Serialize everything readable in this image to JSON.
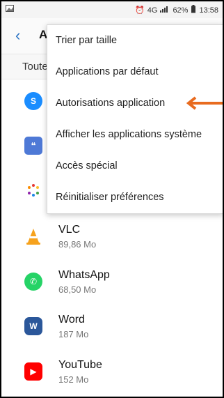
{
  "status_bar": {
    "left_icon": "gallery-icon",
    "right_icons": [
      "alarm-icon",
      "4g-icon",
      "signal-icon"
    ],
    "battery": "62%",
    "time": "13:58"
  },
  "header": {
    "back_icon": "chevron-left-icon",
    "title": "A"
  },
  "filter": {
    "label": "Toute"
  },
  "menu": {
    "items": [
      {
        "label": "Trier par taille"
      },
      {
        "label": "Applications par défaut"
      },
      {
        "label": "Autorisations application"
      },
      {
        "label": "Afficher les applications système"
      },
      {
        "label": "Accès spécial"
      },
      {
        "label": "Réinitialiser préférences"
      }
    ]
  },
  "apps": [
    {
      "name": "",
      "size": "",
      "icon": "shazam-icon",
      "color": "#1a8dff"
    },
    {
      "name": "",
      "size": "",
      "icon": "news-icon",
      "color": "#4e79d6"
    },
    {
      "name": "",
      "size": "",
      "icon": "dots-icon",
      "color": "#ffffff"
    },
    {
      "name": "VLC",
      "size": "89,86 Mo",
      "icon": "vlc-icon",
      "color": "#f6a21d"
    },
    {
      "name": "WhatsApp",
      "size": "68,50 Mo",
      "icon": "whatsapp-icon",
      "color": "#25d366"
    },
    {
      "name": "Word",
      "size": "187 Mo",
      "icon": "word-icon",
      "color": "#2b579a"
    },
    {
      "name": "YouTube",
      "size": "152 Mo",
      "icon": "youtube-icon",
      "color": "#ff0000"
    }
  ],
  "annotation": {
    "arrow_color": "#e86b1f",
    "icon": "arrow-left-icon"
  }
}
